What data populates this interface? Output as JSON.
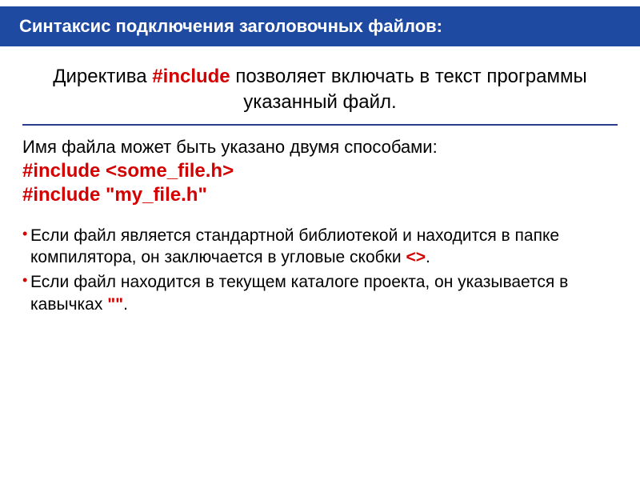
{
  "title": "Синтаксис подключения заголовочных файлов:",
  "lead": {
    "pre": "Директива ",
    "kw": "#include",
    "post": " позволяет включать в текст программы указанный файл."
  },
  "ways_intro": "Имя файла может быть указано двумя способами:",
  "code1": "#include <some_file.h>",
  "code2": "#include \"my_file.h\"",
  "b1": {
    "pre": "Если файл является стандартной библиотекой и находится в папке компилятора, он заключается в угловые скобки ",
    "sym": "<>",
    "post": "."
  },
  "b2": {
    "pre": "Если файл находится в текущем каталоге проекта, он указывается в кавычках ",
    "sym": "\"\"",
    "post": "."
  }
}
